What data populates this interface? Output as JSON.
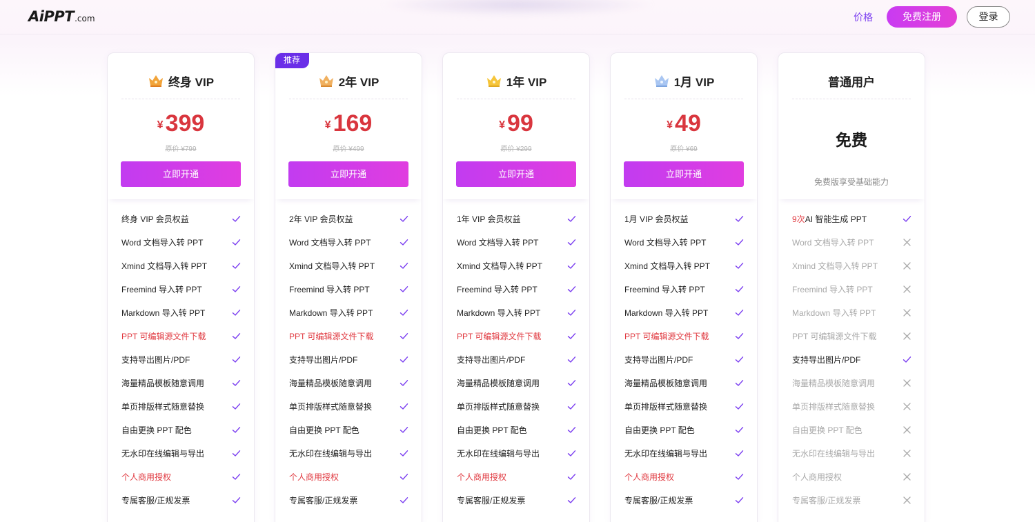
{
  "header": {
    "logo_main": "AiPPT",
    "logo_suffix": ".com",
    "price_link": "价格",
    "register_label": "免费注册",
    "login_label": "登录"
  },
  "colors": {
    "accent_purple": "#7a3df0",
    "button_gradient": [
      "#c23cf0",
      "#e03de0"
    ],
    "price_red": "#d9363e",
    "check": "#7a3df0"
  },
  "plans": [
    {
      "title": "终身 VIP",
      "crown_icon": "crown-orange-icon",
      "currency": "¥",
      "price": "399",
      "original_price": "原价 ¥799",
      "button_label": "立即开通",
      "features": [
        {
          "text": "终身 VIP 会员权益",
          "style": "normal",
          "mark": "check"
        },
        {
          "text": "Word 文档导入转 PPT",
          "style": "normal",
          "mark": "check"
        },
        {
          "text": "Xmind 文档导入转 PPT",
          "style": "normal",
          "mark": "check"
        },
        {
          "text": "Freemind 导入转 PPT",
          "style": "normal",
          "mark": "check"
        },
        {
          "text": "Markdown 导入转 PPT",
          "style": "normal",
          "mark": "check"
        },
        {
          "text": "PPT 可编辑源文件下载",
          "style": "highlight",
          "mark": "check"
        },
        {
          "text": "支持导出图片/PDF",
          "style": "normal",
          "mark": "check"
        },
        {
          "text": "海量精品模板随意调用",
          "style": "normal",
          "mark": "check"
        },
        {
          "text": "单页排版样式随意替换",
          "style": "normal",
          "mark": "check"
        },
        {
          "text": "自由更换 PPT 配色",
          "style": "normal",
          "mark": "check"
        },
        {
          "text": "无水印在线编辑与导出",
          "style": "normal",
          "mark": "check"
        },
        {
          "text": "个人商用授权",
          "style": "highlight",
          "mark": "check"
        },
        {
          "text": "专属客服/正规发票",
          "style": "normal",
          "mark": "check"
        }
      ]
    },
    {
      "title": "2年 VIP",
      "badge": "推荐",
      "crown_icon": "crown-orange-icon",
      "currency": "¥",
      "price": "169",
      "original_price": "原价 ¥499",
      "button_label": "立即开通",
      "features": [
        {
          "text": "2年 VIP 会员权益",
          "style": "normal",
          "mark": "check"
        },
        {
          "text": "Word 文档导入转 PPT",
          "style": "normal",
          "mark": "check"
        },
        {
          "text": "Xmind 文档导入转 PPT",
          "style": "normal",
          "mark": "check"
        },
        {
          "text": "Freemind 导入转 PPT",
          "style": "normal",
          "mark": "check"
        },
        {
          "text": "Markdown 导入转 PPT",
          "style": "normal",
          "mark": "check"
        },
        {
          "text": "PPT 可编辑源文件下载",
          "style": "highlight",
          "mark": "check"
        },
        {
          "text": "支持导出图片/PDF",
          "style": "normal",
          "mark": "check"
        },
        {
          "text": "海量精品模板随意调用",
          "style": "normal",
          "mark": "check"
        },
        {
          "text": "单页排版样式随意替换",
          "style": "normal",
          "mark": "check"
        },
        {
          "text": "自由更换 PPT 配色",
          "style": "normal",
          "mark": "check"
        },
        {
          "text": "无水印在线编辑与导出",
          "style": "normal",
          "mark": "check"
        },
        {
          "text": "个人商用授权",
          "style": "highlight",
          "mark": "check"
        },
        {
          "text": "专属客服/正规发票",
          "style": "normal",
          "mark": "check"
        }
      ]
    },
    {
      "title": "1年 VIP",
      "crown_icon": "crown-yellow-icon",
      "currency": "¥",
      "price": "99",
      "original_price": "原价 ¥299",
      "button_label": "立即开通",
      "features": [
        {
          "text": "1年 VIP 会员权益",
          "style": "normal",
          "mark": "check"
        },
        {
          "text": "Word 文档导入转 PPT",
          "style": "normal",
          "mark": "check"
        },
        {
          "text": "Xmind 文档导入转 PPT",
          "style": "normal",
          "mark": "check"
        },
        {
          "text": "Freemind 导入转 PPT",
          "style": "normal",
          "mark": "check"
        },
        {
          "text": "Markdown 导入转 PPT",
          "style": "normal",
          "mark": "check"
        },
        {
          "text": "PPT 可编辑源文件下载",
          "style": "highlight",
          "mark": "check"
        },
        {
          "text": "支持导出图片/PDF",
          "style": "normal",
          "mark": "check"
        },
        {
          "text": "海量精品模板随意调用",
          "style": "normal",
          "mark": "check"
        },
        {
          "text": "单页排版样式随意替换",
          "style": "normal",
          "mark": "check"
        },
        {
          "text": "自由更换 PPT 配色",
          "style": "normal",
          "mark": "check"
        },
        {
          "text": "无水印在线编辑与导出",
          "style": "normal",
          "mark": "check"
        },
        {
          "text": "个人商用授权",
          "style": "highlight",
          "mark": "check"
        },
        {
          "text": "专属客服/正规发票",
          "style": "normal",
          "mark": "check"
        }
      ]
    },
    {
      "title": "1月 VIP",
      "crown_icon": "crown-blue-icon",
      "currency": "¥",
      "price": "49",
      "original_price": "原价 ¥69",
      "button_label": "立即开通",
      "features": [
        {
          "text": "1月 VIP 会员权益",
          "style": "normal",
          "mark": "check"
        },
        {
          "text": "Word 文档导入转 PPT",
          "style": "normal",
          "mark": "check"
        },
        {
          "text": "Xmind 文档导入转 PPT",
          "style": "normal",
          "mark": "check"
        },
        {
          "text": "Freemind 导入转 PPT",
          "style": "normal",
          "mark": "check"
        },
        {
          "text": "Markdown 导入转 PPT",
          "style": "normal",
          "mark": "check"
        },
        {
          "text": "PPT 可编辑源文件下载",
          "style": "highlight",
          "mark": "check"
        },
        {
          "text": "支持导出图片/PDF",
          "style": "normal",
          "mark": "check"
        },
        {
          "text": "海量精品模板随意调用",
          "style": "normal",
          "mark": "check"
        },
        {
          "text": "单页排版样式随意替换",
          "style": "normal",
          "mark": "check"
        },
        {
          "text": "自由更换 PPT 配色",
          "style": "normal",
          "mark": "check"
        },
        {
          "text": "无水印在线编辑与导出",
          "style": "normal",
          "mark": "check"
        },
        {
          "text": "个人商用授权",
          "style": "highlight",
          "mark": "check"
        },
        {
          "text": "专属客服/正规发票",
          "style": "normal",
          "mark": "check"
        }
      ]
    },
    {
      "title": "普通用户",
      "free_label": "免费",
      "free_desc": "免费版享受基础能力",
      "features": [
        {
          "text": "AI 智能生成 PPT",
          "prefix": "9次",
          "style": "normal",
          "mark": "check"
        },
        {
          "text": "Word 文档导入转 PPT",
          "style": "off",
          "mark": "cross"
        },
        {
          "text": "Xmind 文档导入转 PPT",
          "style": "off",
          "mark": "cross"
        },
        {
          "text": "Freemind 导入转 PPT",
          "style": "off",
          "mark": "cross"
        },
        {
          "text": "Markdown 导入转 PPT",
          "style": "off",
          "mark": "cross"
        },
        {
          "text": "PPT 可编辑源文件下载",
          "style": "off",
          "mark": "cross"
        },
        {
          "text": "支持导出图片/PDF",
          "style": "normal",
          "mark": "check"
        },
        {
          "text": "海量精品模板随意调用",
          "style": "off",
          "mark": "cross"
        },
        {
          "text": "单页排版样式随意替换",
          "style": "off",
          "mark": "cross"
        },
        {
          "text": "自由更换 PPT 配色",
          "style": "off",
          "mark": "cross"
        },
        {
          "text": "无水印在线编辑与导出",
          "style": "off",
          "mark": "cross"
        },
        {
          "text": "个人商用授权",
          "style": "off",
          "mark": "cross"
        },
        {
          "text": "专属客服/正规发票",
          "style": "off",
          "mark": "cross"
        }
      ]
    }
  ]
}
